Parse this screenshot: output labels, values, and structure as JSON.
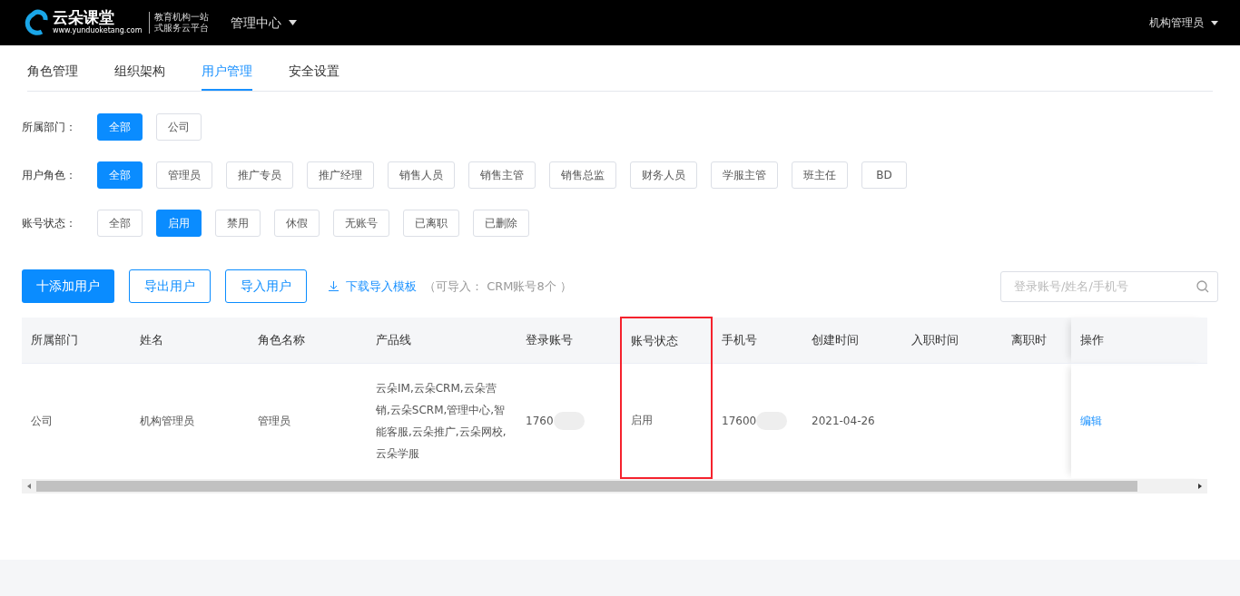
{
  "header": {
    "logo": {
      "name": "云朵课堂",
      "url": "www.yunduoketang.com",
      "slogan_line_1": "教育机构一站",
      "slogan_line_2": "式服务云平台"
    },
    "menu": "管理中心",
    "user": "机构管理员"
  },
  "tabs": [
    {
      "label": "角色管理",
      "selected": false
    },
    {
      "label": "组织架构",
      "selected": false
    },
    {
      "label": "用户管理",
      "selected": true
    },
    {
      "label": "安全设置",
      "selected": false
    }
  ],
  "filters": [
    {
      "label": "所属部门：",
      "options": [
        {
          "label": "全部",
          "selected": true
        },
        {
          "label": "公司",
          "selected": false
        }
      ]
    },
    {
      "label": "用户角色：",
      "options": [
        {
          "label": "全部",
          "selected": true
        },
        {
          "label": "管理员",
          "selected": false
        },
        {
          "label": "推广专员",
          "selected": false
        },
        {
          "label": "推广经理",
          "selected": false
        },
        {
          "label": "销售人员",
          "selected": false
        },
        {
          "label": "销售主管",
          "selected": false
        },
        {
          "label": "销售总监",
          "selected": false
        },
        {
          "label": "财务人员",
          "selected": false
        },
        {
          "label": "学服主管",
          "selected": false
        },
        {
          "label": "班主任",
          "selected": false
        },
        {
          "label": "BD",
          "selected": false
        }
      ]
    },
    {
      "label": "账号状态：",
      "options": [
        {
          "label": "全部",
          "selected": false
        },
        {
          "label": "启用",
          "selected": true
        },
        {
          "label": "禁用",
          "selected": false
        },
        {
          "label": "休假",
          "selected": false
        },
        {
          "label": "无账号",
          "selected": false
        },
        {
          "label": "已离职",
          "selected": false
        },
        {
          "label": "已删除",
          "selected": false
        }
      ]
    }
  ],
  "toolbar": {
    "add_button": "十添加用户",
    "export_button": "导出用户",
    "import_button": "导入用户",
    "download_link": "下载导入模板",
    "import_note": "（可导入： CRM账号8个 ）",
    "search": {
      "placeholder": "登录账号/姓名/手机号"
    }
  },
  "table": {
    "columns": [
      {
        "label": "所属部门",
        "highlighted": false
      },
      {
        "label": "姓名",
        "highlighted": false
      },
      {
        "label": "角色名称",
        "highlighted": false
      },
      {
        "label": "产品线",
        "highlighted": false
      },
      {
        "label": "登录账号",
        "highlighted": false
      },
      {
        "label": "账号状态",
        "highlighted": true
      },
      {
        "label": "手机号",
        "highlighted": false
      },
      {
        "label": "创建时间",
        "highlighted": false
      },
      {
        "label": "入职时间",
        "highlighted": false
      },
      {
        "label": "离职时",
        "highlighted": false
      },
      {
        "label": "操作",
        "highlighted": false
      }
    ],
    "rows": [
      {
        "cells": [
          "公司",
          "机构管理员",
          "管理员",
          "云朵IM,云朵CRM,云朵营销,云朵SCRM,管理中心,智能客服,云朵推广,云朵网校,云朵学服",
          "1760",
          "启用",
          "17600",
          "2021-04-26",
          "",
          ""
        ],
        "action": "编辑"
      }
    ]
  }
}
